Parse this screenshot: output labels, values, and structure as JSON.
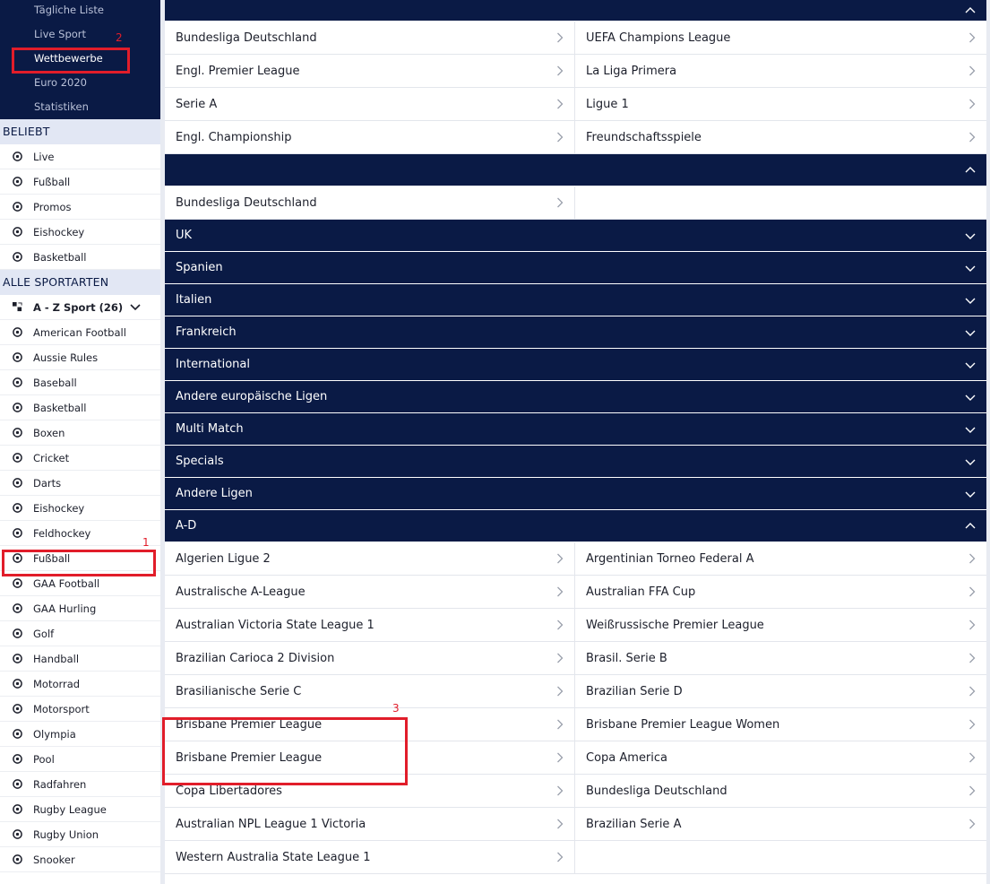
{
  "nav": {
    "items": [
      "Tägliche Liste",
      "Live Sport",
      "Wettbewerbe",
      "Euro 2020",
      "Statistiken"
    ]
  },
  "popular": {
    "heading": "BELIEBT",
    "items": [
      {
        "label": "Live",
        "icon": "live-icon"
      },
      {
        "label": "Fußball",
        "icon": "football-icon"
      },
      {
        "label": "Promos",
        "icon": "promos-icon"
      },
      {
        "label": "Eishockey",
        "icon": "ice-hockey-icon"
      },
      {
        "label": "Basketball",
        "icon": "basketball-icon"
      }
    ]
  },
  "all_sports": {
    "heading": "ALLE SPORTARTEN",
    "az_label": "A - Z Sport (26)",
    "items": [
      {
        "label": "American Football",
        "icon": "american-football-icon"
      },
      {
        "label": "Aussie Rules",
        "icon": "aussie-rules-icon"
      },
      {
        "label": "Baseball",
        "icon": "baseball-icon"
      },
      {
        "label": "Basketball",
        "icon": "basketball-icon"
      },
      {
        "label": "Boxen",
        "icon": "boxing-icon"
      },
      {
        "label": "Cricket",
        "icon": "cricket-icon"
      },
      {
        "label": "Darts",
        "icon": "darts-icon"
      },
      {
        "label": "Eishockey",
        "icon": "ice-hockey-icon"
      },
      {
        "label": "Feldhockey",
        "icon": "field-hockey-icon"
      },
      {
        "label": "Fußball",
        "icon": "football-icon"
      },
      {
        "label": "GAA Football",
        "icon": "gaa-football-icon"
      },
      {
        "label": "GAA Hurling",
        "icon": "hurling-icon"
      },
      {
        "label": "Golf",
        "icon": "golf-icon"
      },
      {
        "label": "Handball",
        "icon": "handball-icon"
      },
      {
        "label": "Motorrad",
        "icon": "motorbike-icon"
      },
      {
        "label": "Motorsport",
        "icon": "motorsport-icon"
      },
      {
        "label": "Olympia",
        "icon": "olympics-icon"
      },
      {
        "label": "Pool",
        "icon": "pool-icon"
      },
      {
        "label": "Radfahren",
        "icon": "cycling-icon"
      },
      {
        "label": "Rugby League",
        "icon": "rugby-league-icon"
      },
      {
        "label": "Rugby Union",
        "icon": "rugby-union-icon"
      },
      {
        "label": "Snooker",
        "icon": "snooker-icon"
      }
    ]
  },
  "top_competitions": [
    "Bundesliga Deutschland",
    "UEFA Champions League",
    "Engl. Premier League",
    "La Liga Primera",
    "Serie A",
    "Ligue 1",
    "Engl. Championship",
    "Freundschaftsspiele"
  ],
  "second_group": [
    "Bundesliga Deutschland"
  ],
  "collapsed_sections": [
    "UK",
    "Spanien",
    "Italien",
    "Frankreich",
    "International",
    "Andere europäische Ligen",
    "Multi Match",
    "Specials",
    "Andere Ligen"
  ],
  "ad_section": {
    "title": "A-D",
    "leagues": [
      "Algerien Ligue 2",
      "Argentinian Torneo Federal A",
      "Australische A-League",
      "Australian FFA Cup",
      "Australian Victoria State League 1",
      "Weißrussische Premier League",
      "Brazilian Carioca 2 Division",
      "Brasil. Serie B",
      "Brasilianische Serie C",
      "Brazilian Serie D",
      "Brisbane Premier League",
      "Brisbane Premier League Women",
      "Brisbane Premier League",
      "Copa America",
      "Copa Libertadores",
      "Bundesliga Deutschland",
      "Australian NPL League 1 Victoria",
      "Brazilian Serie A",
      "Western Australia State League 1"
    ]
  },
  "annotations": [
    "1",
    "2",
    "3"
  ],
  "colors": {
    "navy": "#0a1a45",
    "highlight": "#e11d2a",
    "section_bg": "#e2e7f4"
  }
}
